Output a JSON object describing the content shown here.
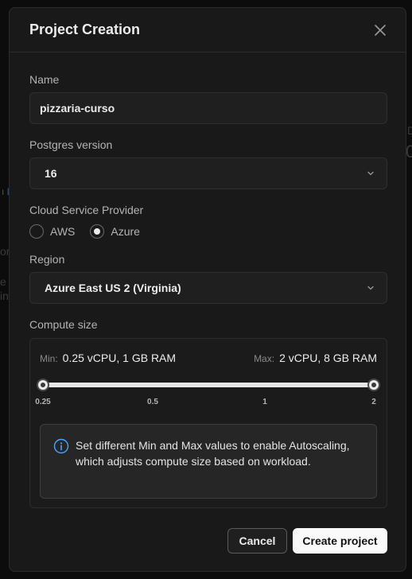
{
  "modal": {
    "title": "Project Creation"
  },
  "name": {
    "label": "Name",
    "value": "pizzaria-curso"
  },
  "postgres": {
    "label": "Postgres version",
    "value": "16"
  },
  "provider": {
    "label": "Cloud Service Provider",
    "options": [
      {
        "label": "AWS",
        "selected": false
      },
      {
        "label": "Azure",
        "selected": true
      }
    ]
  },
  "region": {
    "label": "Region",
    "value": "Azure East US 2 (Virginia)"
  },
  "compute": {
    "label": "Compute size",
    "min_key": "Min:",
    "min_value": "0.25 vCPU, 1 GB RAM",
    "max_key": "Max:",
    "max_value": "2 vCPU, 8 GB RAM",
    "slider_min": 0.25,
    "slider_max": 2,
    "ticks": [
      "0.25",
      "0.5",
      "1",
      "2"
    ],
    "info": "Set different Min and Max values to enable Autoscaling, which adjusts compute size based on workload."
  },
  "actions": {
    "cancel": "Cancel",
    "create": "Create project"
  },
  "colors": {
    "background": "#191919",
    "field": "#1f1f1f",
    "primary_button": "#fafafa",
    "info_icon": "#4aa3ff"
  }
}
